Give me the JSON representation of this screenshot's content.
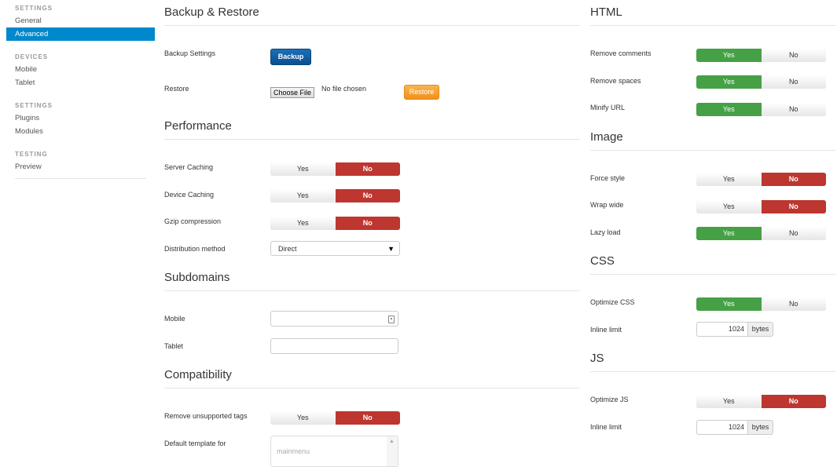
{
  "sidebar": {
    "groups": [
      {
        "header": "SETTINGS",
        "items": [
          "General",
          "Advanced"
        ]
      },
      {
        "header": "DEVICES",
        "items": [
          "Mobile",
          "Tablet"
        ]
      },
      {
        "header": "SETTINGS",
        "items": [
          "Plugins",
          "Modules"
        ]
      },
      {
        "header": "TESTING",
        "items": [
          "Preview"
        ]
      }
    ],
    "active": "Advanced"
  },
  "backup": {
    "title": "Backup & Restore",
    "backup_label": "Backup Settings",
    "backup_button": "Backup",
    "restore_label": "Restore",
    "choose_file": "Choose File",
    "no_file": "No file chosen",
    "restore_button": "Restore"
  },
  "performance": {
    "title": "Performance",
    "server_caching": {
      "label": "Server Caching",
      "value": "No"
    },
    "device_caching": {
      "label": "Device Caching",
      "value": "No"
    },
    "gzip": {
      "label": "Gzip compression",
      "value": "No"
    },
    "distribution": {
      "label": "Distribution method",
      "value": "Direct"
    }
  },
  "subdomains": {
    "title": "Subdomains",
    "mobile": {
      "label": "Mobile",
      "value": ""
    },
    "tablet": {
      "label": "Tablet",
      "value": ""
    }
  },
  "compatibility": {
    "title": "Compatibility",
    "remove_tags": {
      "label": "Remove unsupported tags",
      "value": "No"
    },
    "default_template": {
      "label": "Default template for",
      "option": "mainmenu"
    }
  },
  "html": {
    "title": "HTML",
    "remove_comments": {
      "label": "Remove comments",
      "value": "Yes"
    },
    "remove_spaces": {
      "label": "Remove spaces",
      "value": "Yes"
    },
    "minify_url": {
      "label": "Minify URL",
      "value": "Yes"
    }
  },
  "image": {
    "title": "Image",
    "force_style": {
      "label": "Force style",
      "value": "No"
    },
    "wrap_wide": {
      "label": "Wrap wide",
      "value": "No"
    },
    "lazy_load": {
      "label": "Lazy load",
      "value": "Yes"
    }
  },
  "css": {
    "title": "CSS",
    "optimize": {
      "label": "Optimize CSS",
      "value": "Yes"
    },
    "inline_limit": {
      "label": "Inline limit",
      "value": "1024",
      "unit": "bytes"
    }
  },
  "js": {
    "title": "JS",
    "optimize": {
      "label": "Optimize JS",
      "value": "No"
    },
    "inline_limit": {
      "label": "Inline limit",
      "value": "1024",
      "unit": "bytes"
    }
  },
  "toggle_labels": {
    "yes": "Yes",
    "no": "No"
  },
  "colors": {
    "active_nav": "#0088cc",
    "yes_on": "#46a046",
    "no_on": "#bd362f",
    "primary": "#0b4f8f",
    "warning": "#f0901a"
  }
}
